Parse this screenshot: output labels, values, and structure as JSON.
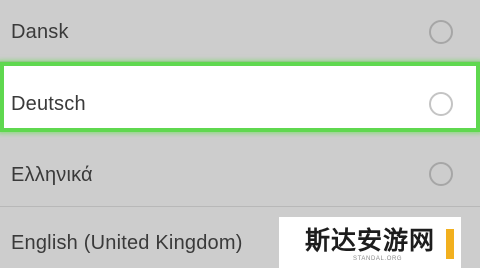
{
  "languages": [
    {
      "label": "Dansk",
      "selected": false,
      "highlighted": false
    },
    {
      "label": "Deutsch",
      "selected": false,
      "highlighted": true
    },
    {
      "label": "Ελληνικά",
      "selected": false,
      "highlighted": false
    },
    {
      "label": "English (United Kingdom)",
      "selected": false,
      "highlighted": false
    }
  ],
  "watermark": {
    "text": "斯达安游网",
    "subtext": "STANDAL.ORG"
  },
  "colors": {
    "background": "#cdcdcd",
    "highlight_border": "#5fd84f",
    "highlight_fill": "#ffffff",
    "radio_border": "#a6a6a6",
    "label_text": "#3a3a3a",
    "watermark_accent": "#f2b01e"
  }
}
